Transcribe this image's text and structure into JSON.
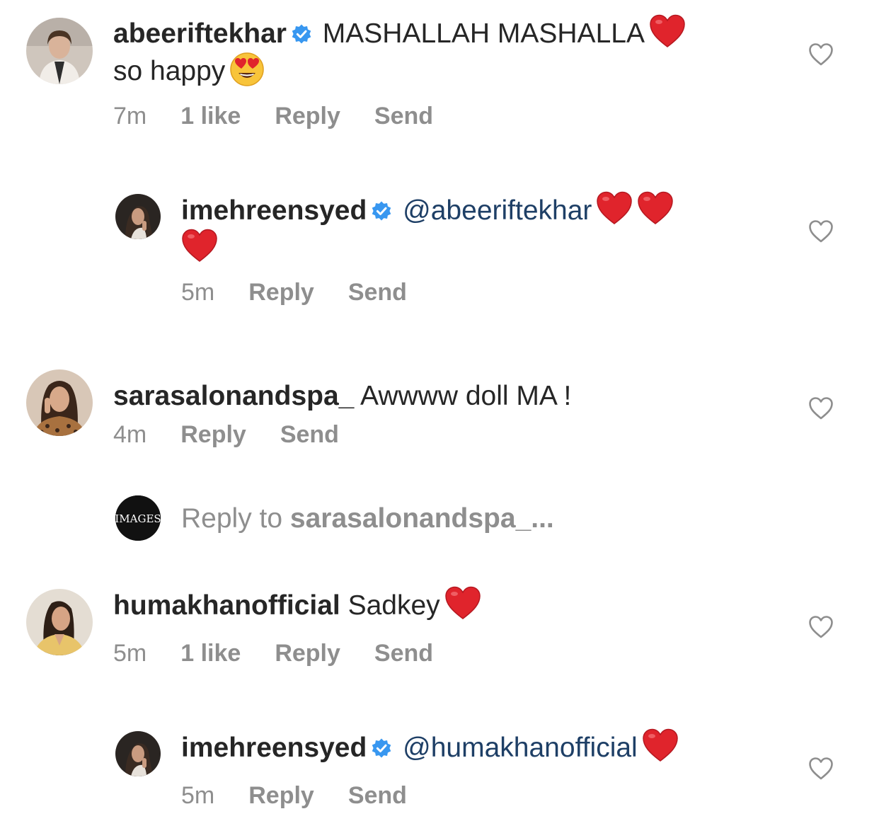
{
  "comments": [
    {
      "username": "abeeriftekhar",
      "verified": true,
      "text_line1": "MASHALLAH MASHALLA",
      "text_line2": "so happy",
      "time": "7m",
      "likes": "1 like",
      "reply": "Reply",
      "send": "Send"
    },
    {
      "username": "imehreensyed",
      "verified": true,
      "mention": "@abeeriftekhar",
      "time": "5m",
      "reply": "Reply",
      "send": "Send"
    },
    {
      "username": "sarasalonandspa_",
      "text": "Awwww doll MA !",
      "time": "4m",
      "reply": "Reply",
      "send": "Send"
    },
    {
      "username": "humakhanofficial",
      "text": "Sadkey",
      "time": "5m",
      "likes": "1 like",
      "reply": "Reply",
      "send": "Send"
    },
    {
      "username": "imehreensyed",
      "verified": true,
      "mention": "@humakhanofficial",
      "time": "5m",
      "reply": "Reply",
      "send": "Send"
    }
  ],
  "reply_prompt": {
    "avatar_text": "IMAGES",
    "prefix": "Reply to",
    "target": "sarasalonandspa_..."
  },
  "icons": {
    "verified": "verified-badge-icon",
    "like": "heart-outline-icon",
    "heart_emoji": "red-heart-emoji",
    "heart_eyes_emoji": "heart-eyes-emoji"
  },
  "colors": {
    "text": "#262626",
    "meta": "#8e8e8e",
    "mention": "#1e3f66",
    "verified": "#3897f0",
    "heart": "#e0242c"
  }
}
